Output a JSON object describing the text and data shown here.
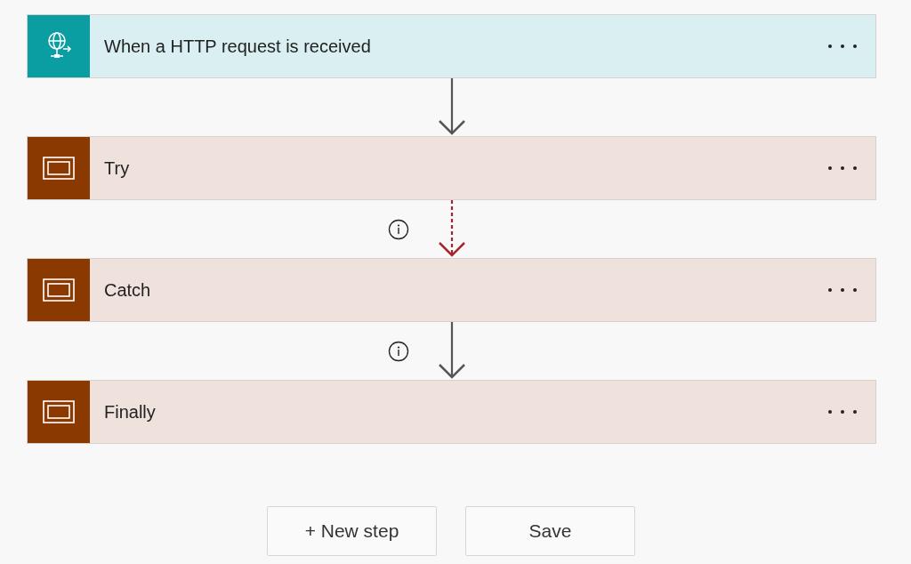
{
  "steps": [
    {
      "kind": "trigger",
      "title": "When a HTTP request is received"
    },
    {
      "kind": "scope",
      "title": "Try"
    },
    {
      "kind": "scope",
      "title": "Catch"
    },
    {
      "kind": "scope",
      "title": "Finally"
    }
  ],
  "connectors": [
    {
      "kind": "normal",
      "info": false
    },
    {
      "kind": "failed",
      "info": true
    },
    {
      "kind": "normal",
      "info": true
    }
  ],
  "buttons": [
    {
      "label": "+ New step"
    },
    {
      "label": "Save"
    }
  ]
}
